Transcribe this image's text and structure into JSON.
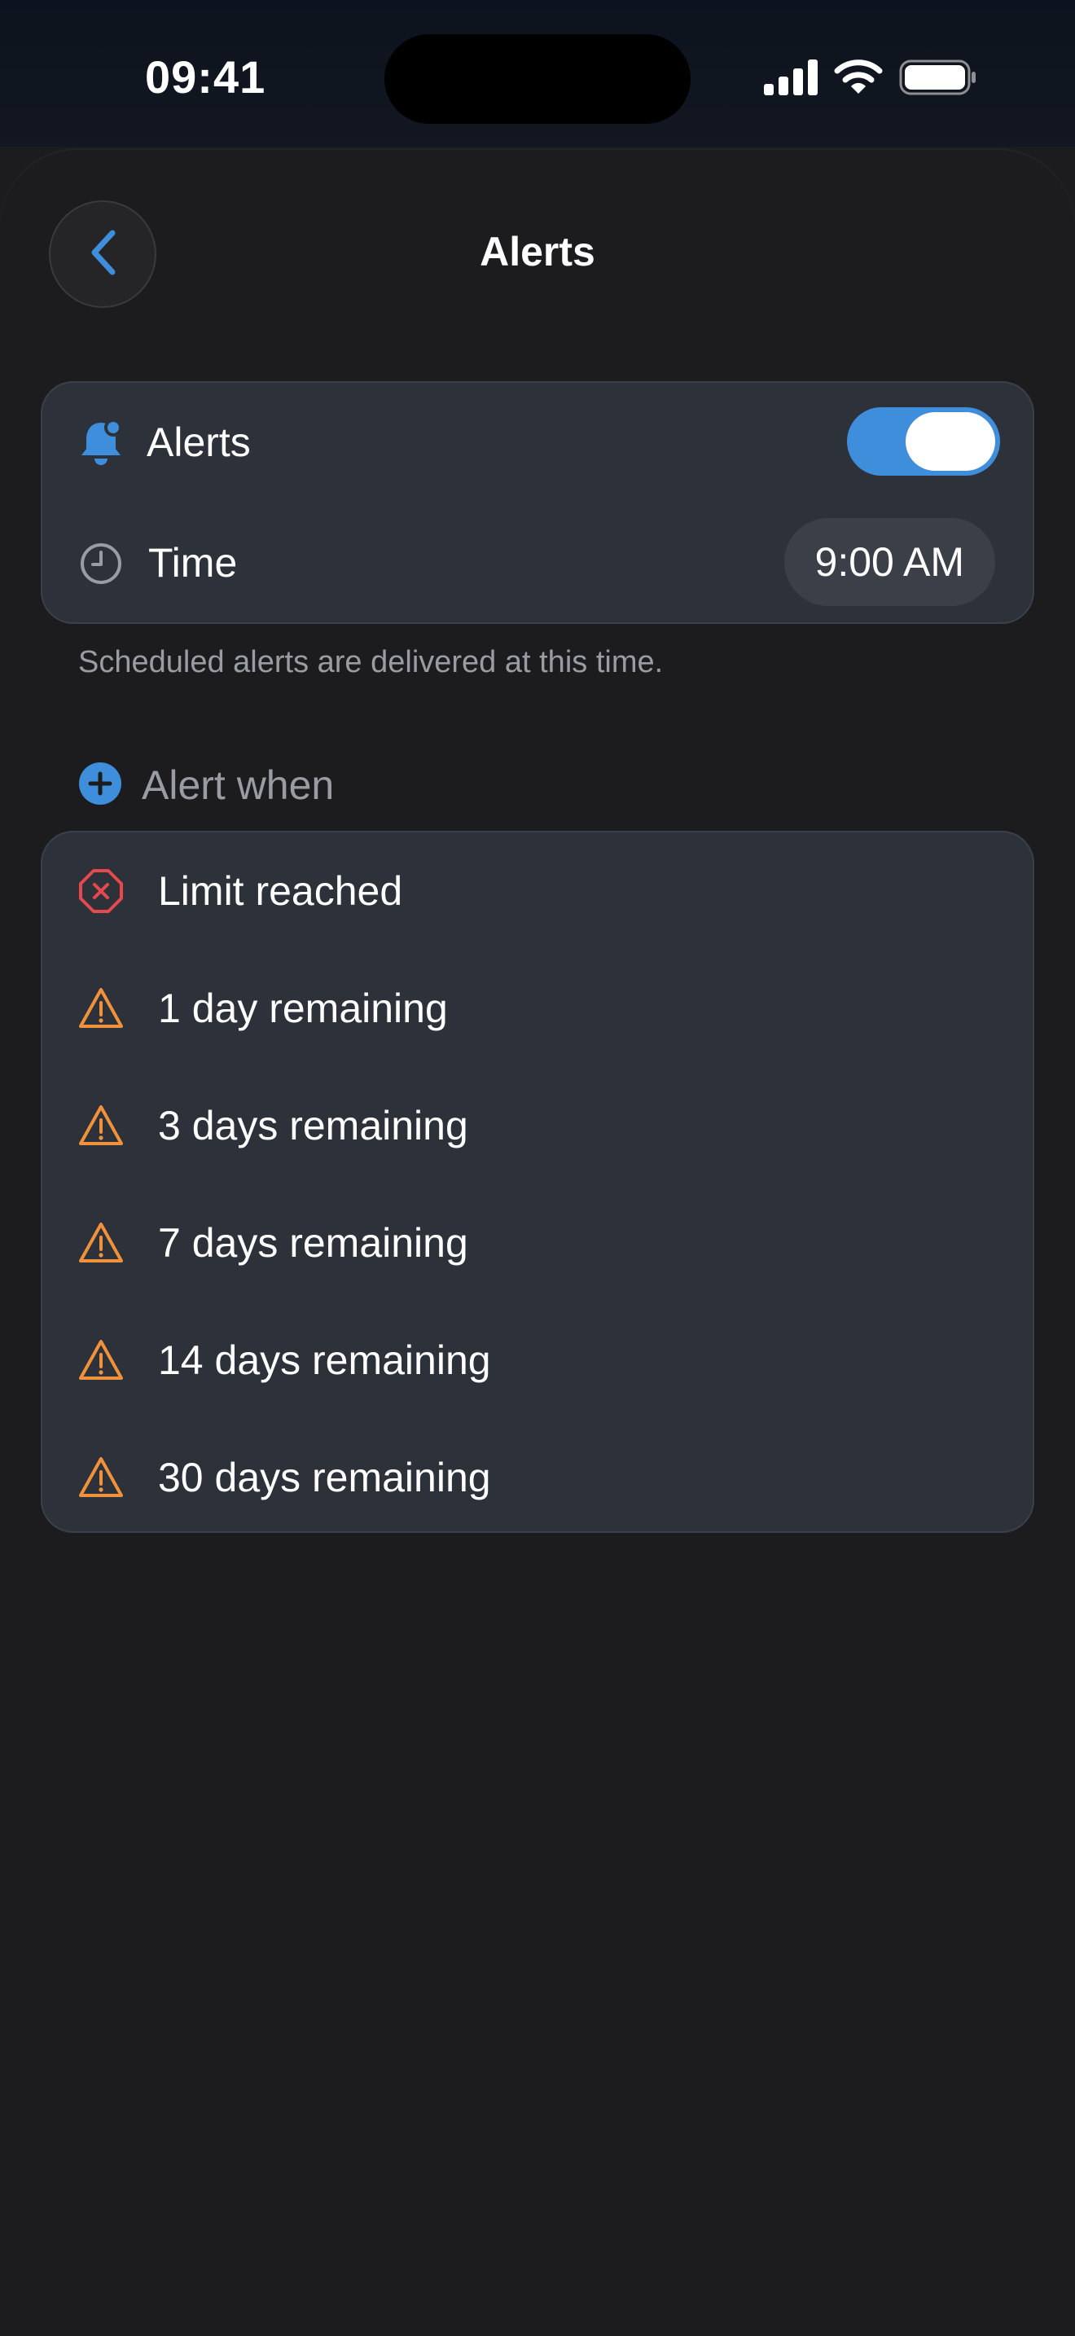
{
  "status_bar": {
    "time": "09:41",
    "icons": [
      "cellular-signal-icon",
      "wifi-icon",
      "battery-icon"
    ]
  },
  "nav": {
    "back_icon": "chevron-left-icon",
    "title": "Alerts"
  },
  "settings": {
    "alerts": {
      "label": "Alerts",
      "icon": "bell-badge-icon",
      "enabled": true
    },
    "time": {
      "label": "Time",
      "icon": "clock-icon",
      "value": "9:00 AM"
    },
    "footnote": "Scheduled alerts are delivered at this time."
  },
  "alert_when": {
    "header": "Alert when",
    "header_icon": "plus-circle-icon",
    "items": [
      {
        "label": "Limit reached",
        "icon": "x-octagon-icon"
      },
      {
        "label": "1 day remaining",
        "icon": "warning-triangle-icon"
      },
      {
        "label": "3 days remaining",
        "icon": "warning-triangle-icon"
      },
      {
        "label": "7 days remaining",
        "icon": "warning-triangle-icon"
      },
      {
        "label": "14 days remaining",
        "icon": "warning-triangle-icon"
      },
      {
        "label": "30 days remaining",
        "icon": "warning-triangle-icon"
      }
    ]
  },
  "colors": {
    "accent": "#3e8edb",
    "warning": "#f0923a",
    "danger": "#e5484d",
    "card": "#2c313a",
    "background": "#1c1c1e"
  }
}
